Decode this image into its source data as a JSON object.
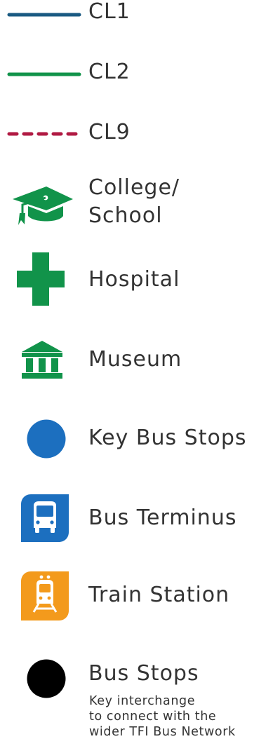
{
  "legend": {
    "items": [
      {
        "id": "cl1",
        "label": "CL1",
        "symbol": "solid-line",
        "color": "#1a5a82"
      },
      {
        "id": "cl2",
        "label": "CL2",
        "symbol": "solid-line",
        "color": "#11934a"
      },
      {
        "id": "cl9",
        "label": "CL9",
        "symbol": "dashed-line",
        "color": "#b01942"
      },
      {
        "id": "college",
        "label_lines": [
          "College/",
          "School"
        ],
        "symbol": "graduation-cap-icon",
        "color": "#11934a"
      },
      {
        "id": "hospital",
        "label": "Hospital",
        "symbol": "medical-cross-icon",
        "color": "#11934a"
      },
      {
        "id": "museum",
        "label": "Museum",
        "symbol": "museum-building-icon",
        "color": "#11934a"
      },
      {
        "id": "key-bus-stops",
        "label": "Key Bus Stops",
        "symbol": "filled-circle",
        "color": "#1c6fbf"
      },
      {
        "id": "bus-terminus",
        "label": "Bus Terminus",
        "symbol": "bus-front-icon",
        "color": "#1c6fbf"
      },
      {
        "id": "train-station",
        "label": "Train Station",
        "symbol": "train-front-icon",
        "color": "#f39a1c"
      },
      {
        "id": "bus-stops",
        "label": "Bus Stops",
        "symbol": "filled-circle",
        "color": "#000000",
        "note_lines": [
          "Key interchange",
          "to connect with the",
          "wider TFI Bus Network"
        ]
      }
    ]
  }
}
